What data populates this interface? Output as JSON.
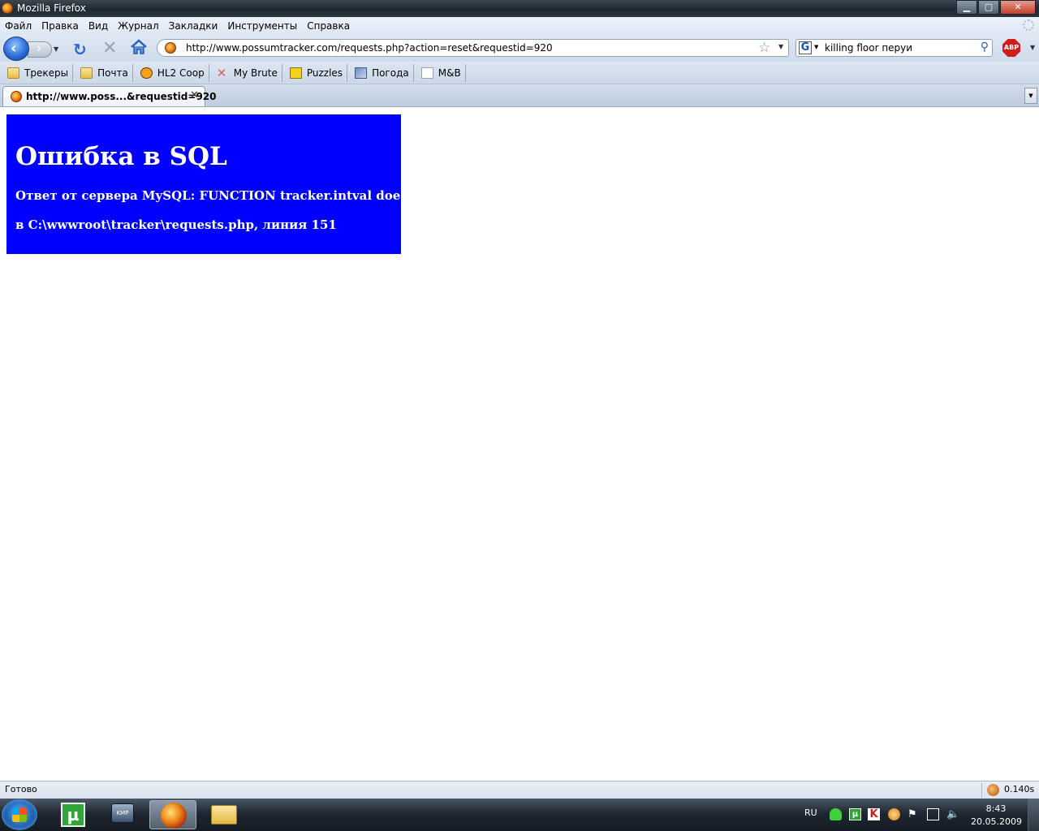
{
  "window": {
    "title": "Mozilla Firefox",
    "controls": [
      "minimize",
      "maximize",
      "close"
    ]
  },
  "menu": [
    "Файл",
    "Правка",
    "Вид",
    "Журнал",
    "Закладки",
    "Инструменты",
    "Справка"
  ],
  "nav": {
    "url": "http://www.possumtracker.com/requests.php?action=reset&requestid=920",
    "search_value": "killing floor перуи",
    "search_engine": "G",
    "addon_label": "ABP"
  },
  "bookmarks": [
    {
      "label": "Трекеры",
      "icon": "folder-icon"
    },
    {
      "label": "Почта",
      "icon": "folder-icon"
    },
    {
      "label": "HL2 Coop",
      "icon": "halflife-icon"
    },
    {
      "label": "My Brute",
      "icon": "mybrute-icon"
    },
    {
      "label": "Puzzles",
      "icon": "puzzle-icon"
    },
    {
      "label": "Погода",
      "icon": "weather-icon"
    },
    {
      "label": "M&B",
      "icon": "page-icon"
    }
  ],
  "tabs": [
    {
      "label": "http://www.poss...&requestid=920",
      "active": true
    }
  ],
  "page": {
    "error_title": "Ошибка в SQL",
    "error_message": "Ответ от сервера MySQL: FUNCTION tracker.intval does not exist",
    "error_location": "в C:\\wwwroot\\tracker\\requests.php, линия 151",
    "background_color": "#0000ff",
    "text_color": "#ffffff"
  },
  "status": {
    "text": "Готово",
    "timer": "0.140s"
  },
  "taskbar": {
    "apps": [
      "utorrent-icon",
      "kmplayer-icon",
      "firefox-icon",
      "explorer-icon"
    ],
    "kmp_label": "KMP",
    "utorrent_label": "µ",
    "language": "RU",
    "clock_time": "8:43",
    "clock_date": "20.05.2009"
  }
}
